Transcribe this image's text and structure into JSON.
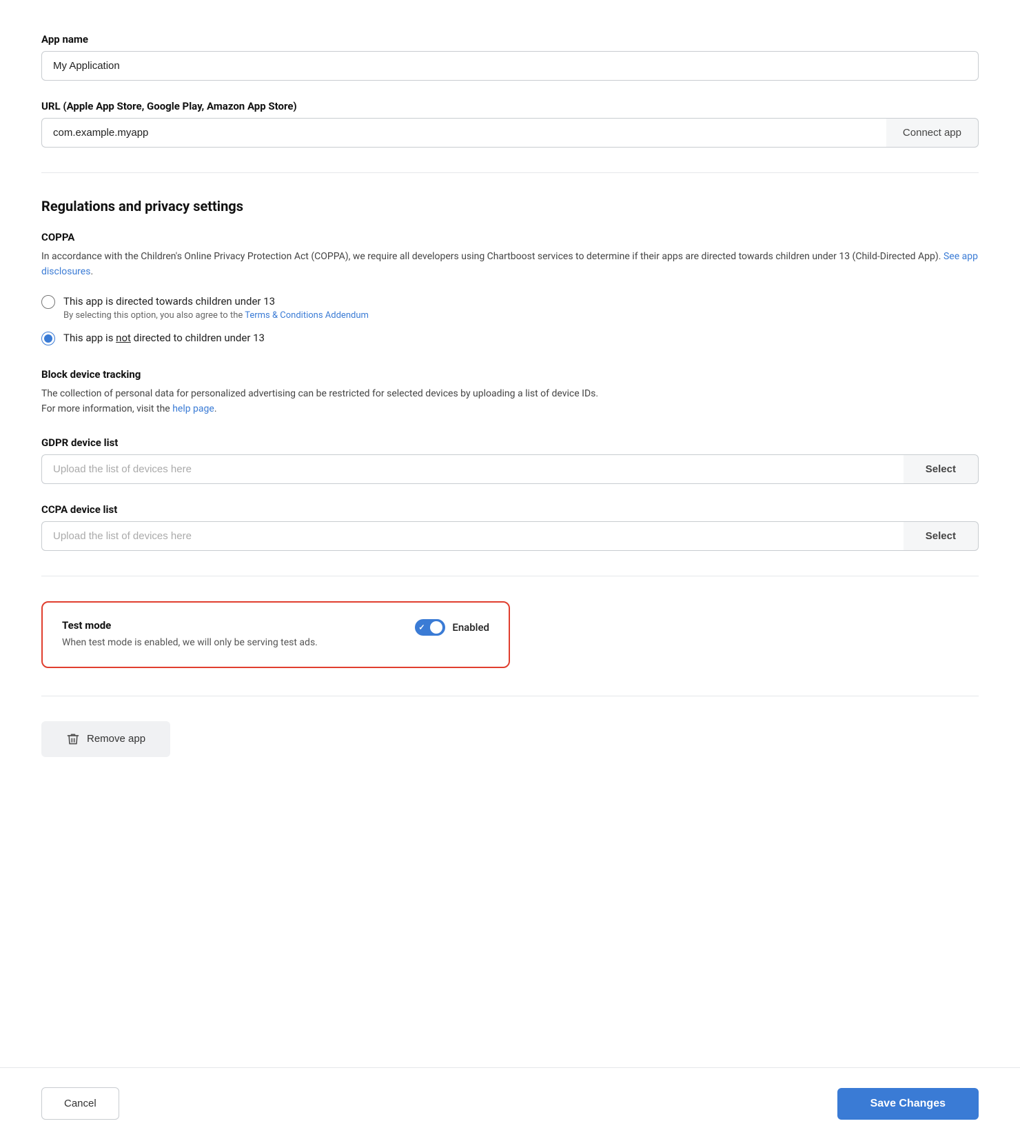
{
  "app_name": {
    "label": "App name",
    "value": "My Application",
    "placeholder": "My Application"
  },
  "url": {
    "label": "URL (Apple App Store, Google Play, Amazon App Store)",
    "value": "com.example.myapp",
    "placeholder": "com.example.myapp",
    "connect_btn": "Connect app"
  },
  "regulations": {
    "heading": "Regulations and privacy settings",
    "coppa": {
      "sub_heading": "COPPA",
      "description_1": "In accordance with the Children's Online Privacy Protection Act (COPPA), we require all developers using Chartboost services to determine if their apps are directed towards children under 13 (Child-Directed App).",
      "see_app_disclosures": "See app disclosures",
      "radio_option_1": {
        "label": "This app is directed towards children under 13",
        "sublabel_prefix": "By selecting this option, you also agree to the ",
        "sublabel_link": "Terms & Conditions Addendum",
        "checked": false
      },
      "radio_option_2": {
        "label_prefix": "This app is ",
        "label_underline": "not",
        "label_suffix": " directed to children under 13",
        "checked": true
      }
    },
    "block_device": {
      "sub_heading": "Block device tracking",
      "description_1": "The collection of personal data for personalized advertising can be restricted for selected devices by uploading a list of device IDs.",
      "description_2": "For more information, visit the ",
      "help_page_link": "help page"
    },
    "gdpr": {
      "label": "GDPR device list",
      "placeholder": "Upload the list of devices here",
      "select_btn": "Select"
    },
    "ccpa": {
      "label": "CCPA device list",
      "placeholder": "Upload the list of devices here",
      "select_btn": "Select"
    }
  },
  "test_mode": {
    "title": "Test mode",
    "description": "When test mode is enabled, we will only be serving test ads.",
    "toggle_label": "Enabled",
    "enabled": true
  },
  "remove_app": {
    "label": "Remove app"
  },
  "footer": {
    "cancel_label": "Cancel",
    "save_label": "Save Changes"
  }
}
